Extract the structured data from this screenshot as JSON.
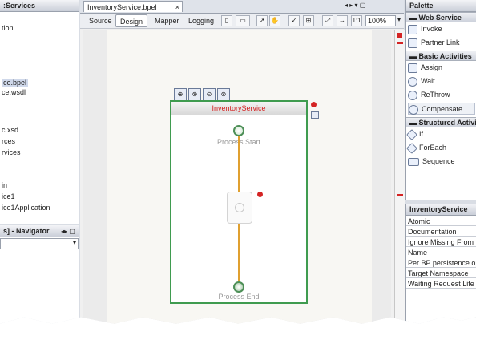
{
  "services_panel": {
    "title": ":Services",
    "items": [
      "tion",
      "ce.bpel",
      "ce.wsdl",
      "c.xsd",
      "rces",
      "rvices",
      "in",
      "ice1",
      "ice1Application"
    ]
  },
  "navigator_panel": {
    "title": "s] - Navigator"
  },
  "editor": {
    "doc_tab": "InventoryService.bpel",
    "views": [
      "Source",
      "Design",
      "Mapper",
      "Logging"
    ],
    "active_view": "Design",
    "zoom": "100%"
  },
  "diagram": {
    "process_name": "InventoryService",
    "start_label": "Process Start",
    "end_label": "Process End"
  },
  "palette": {
    "title": "Palette",
    "categories": [
      {
        "name": "Web Service",
        "items": [
          "Invoke",
          "Partner Link"
        ]
      },
      {
        "name": "Basic Activities",
        "items": [
          "Assign",
          "Wait",
          "ReThrow",
          "Compensate"
        ]
      },
      {
        "name": "Structured Activi",
        "items": [
          "If",
          "ForEach",
          "Sequence"
        ]
      }
    ]
  },
  "properties": {
    "title": "InventoryService",
    "rows": [
      "Atomic",
      "Documentation",
      "Ignore Missing From D",
      "Name",
      "Per BP persistence op",
      "Target Namespace",
      "Waiting Request Life S"
    ]
  },
  "colors": {
    "scope_border": "#3f9b4f",
    "flow_line": "#e0a030",
    "title_text": "#d32020",
    "error": "#d42424"
  }
}
